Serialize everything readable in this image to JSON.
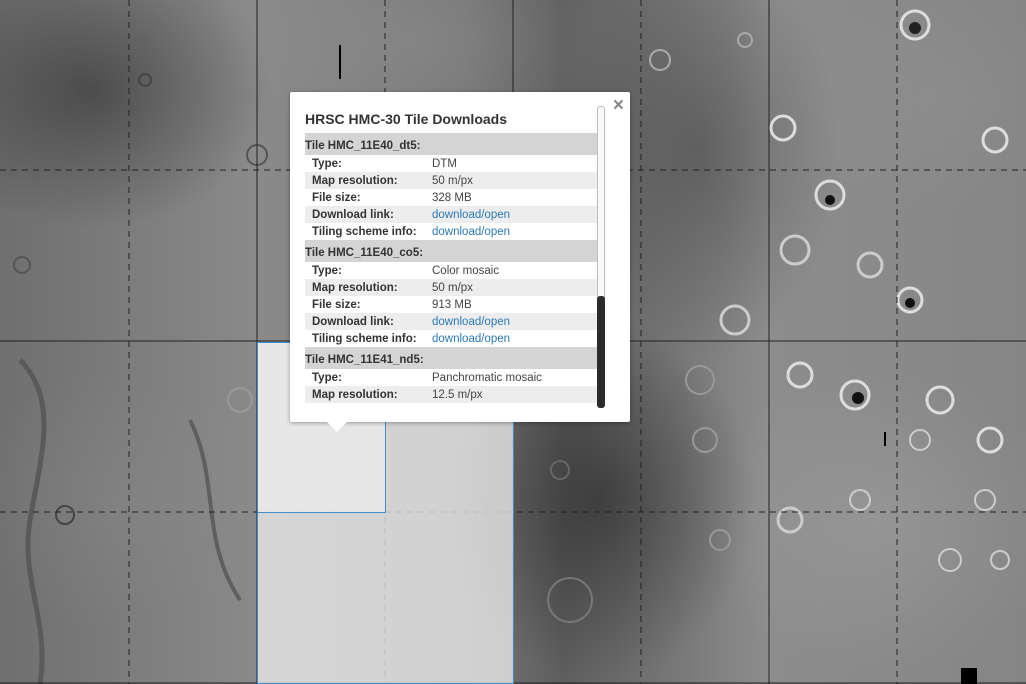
{
  "map": {
    "accent_color": "#3f8fd0"
  },
  "popup": {
    "title": "HRSC HMC-30 Tile Downloads",
    "close_symbol": "×",
    "tiles": [
      {
        "heading": "Tile HMC_11E40_dt5:",
        "rows": [
          {
            "key": "Type:",
            "value": "DTM",
            "link": false
          },
          {
            "key": "Map resolution:",
            "value": "50 m/px",
            "link": false
          },
          {
            "key": "File size:",
            "value": "328 MB",
            "link": false
          },
          {
            "key": "Download link:",
            "value": "download/open",
            "link": true
          },
          {
            "key": "Tiling scheme info:",
            "value": "download/open",
            "link": true
          }
        ]
      },
      {
        "heading": "Tile HMC_11E40_co5:",
        "rows": [
          {
            "key": "Type:",
            "value": "Color mosaic",
            "link": false
          },
          {
            "key": "Map resolution:",
            "value": "50 m/px",
            "link": false
          },
          {
            "key": "File size:",
            "value": "913 MB",
            "link": false
          },
          {
            "key": "Download link:",
            "value": "download/open",
            "link": true
          },
          {
            "key": "Tiling scheme info:",
            "value": "download/open",
            "link": true
          }
        ]
      },
      {
        "heading": "Tile HMC_11E41_nd5:",
        "rows": [
          {
            "key": "Type:",
            "value": "Panchromatic mosaic",
            "link": false
          },
          {
            "key": "Map resolution:",
            "value": "12.5 m/px",
            "link": false
          }
        ]
      }
    ]
  }
}
